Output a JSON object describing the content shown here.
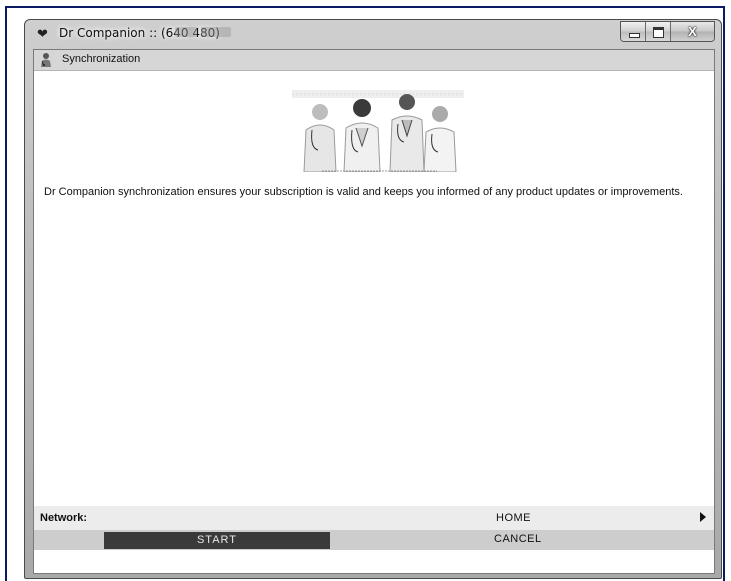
{
  "window": {
    "title": "Dr Companion :: (640 480)",
    "icon": "heart-icon",
    "controls": [
      "minimize-icon",
      "maximize-icon",
      "close-icon"
    ],
    "close_glyph": "X"
  },
  "section": {
    "title": "Synchronization",
    "icon": "medical-staff-icon"
  },
  "banner": {
    "image": "doctors-group-illustration"
  },
  "description": "Dr Companion synchronization ensures your subscription is valid and keeps you informed of any product updates or improvements.",
  "network": {
    "label": "Network:",
    "value": "HOME",
    "arrow": "chevron-right-icon"
  },
  "actions": {
    "start": "START",
    "cancel": "CANCEL"
  },
  "colors": {
    "frame_border": "#0c1a66",
    "start_button_bg": "#3a3a3a",
    "header_bg": "#d6d6d6"
  }
}
